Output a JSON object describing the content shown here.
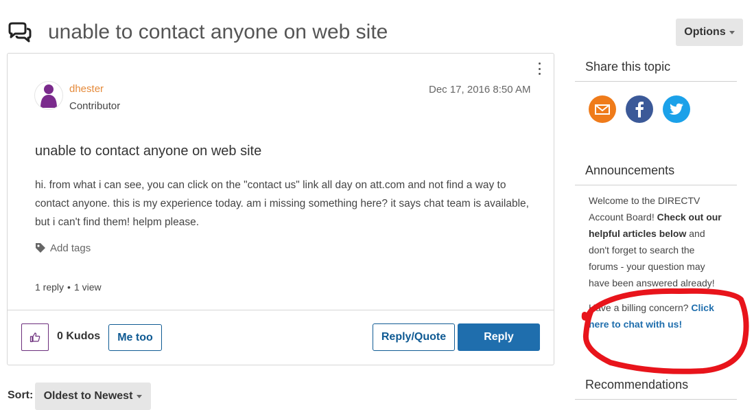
{
  "topic": {
    "title": "unable to contact anyone on web site",
    "options_label": "Options"
  },
  "post": {
    "author": "dhester",
    "rank": "Contributor",
    "date": "Dec 17, 2016",
    "time": "8:50 AM",
    "subject": "unable to contact anyone on web site",
    "body": "hi. from what i can see, you can click on the \"contact us\" link all day on att.com and not find a way to contact anyone. this is my experience today. am i missing something here? it says chat team is available, but i can't find them! helpm please.",
    "add_tags_label": "Add tags",
    "replies": "1 reply",
    "views": "1 view",
    "stats_separator": "•",
    "kudos_count": "0",
    "kudos_label": "Kudos",
    "me_too_label": "Me too",
    "reply_quote_label": "Reply/Quote",
    "reply_label": "Reply"
  },
  "sort": {
    "label": "Sort:",
    "selected": "Oldest to Newest"
  },
  "sidebar": {
    "share_heading": "Share this topic",
    "announcements_heading": "Announcements",
    "announcement_part1": "Welcome to the DIRECTV Account Board! ",
    "announcement_bold": "Check out our helpful articles below",
    "announcement_part2": " and don't forget to search the forums - your question may have been answered already!",
    "billing_text": "Have a billing concern? ",
    "billing_link": "Click here to chat with us!",
    "recommendations_heading": "Recommendations"
  },
  "colors": {
    "accent_blue": "#1f6ead",
    "author_orange": "#e58a3a",
    "avatar_purple": "#7a2a8c",
    "email_orange": "#ef7b1a",
    "facebook_blue": "#3b5998",
    "twitter_blue": "#1ba1e9",
    "annotation_red": "#e8141b"
  },
  "icons": {
    "topic": "speech-bubbles-icon",
    "kebab": "kebab-menu-icon",
    "tag": "tag-icon",
    "kudo": "thumbs-up-icon",
    "email": "email-icon",
    "facebook": "facebook-icon",
    "twitter": "twitter-icon"
  }
}
